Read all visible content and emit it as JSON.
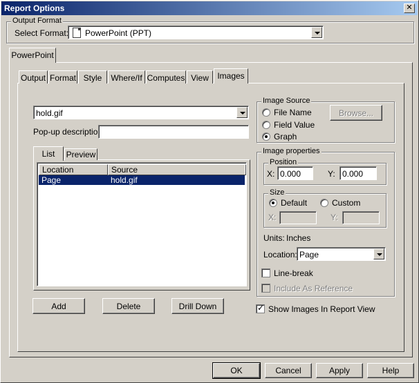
{
  "window": {
    "title": "Report Options",
    "close_glyph": "✕"
  },
  "output_format": {
    "group_label": "Output Format",
    "select_label": "Select Format:",
    "selected": "PowerPoint (PPT)"
  },
  "outer_tab": "PowerPoint",
  "tabs": [
    "Output",
    "Format",
    "Style",
    "Where/If",
    "Computes",
    "View",
    "Images"
  ],
  "images": {
    "image_combo": "hold.gif",
    "popup_label": "Pop-up description:",
    "popup_value": "",
    "subtabs": [
      "List",
      "Preview"
    ],
    "columns": [
      "Location",
      "Source"
    ],
    "rows": [
      {
        "location": "Page",
        "source": "hold.gif"
      }
    ],
    "buttons": {
      "add": "Add",
      "delete": "Delete",
      "drill_down": "Drill Down"
    }
  },
  "image_source": {
    "group_label": "Image Source",
    "options": [
      "File Name",
      "Field Value",
      "Graph"
    ],
    "selected": "Graph",
    "browse": "Browse..."
  },
  "image_properties": {
    "group_label": "Image properties",
    "position_label": "Position",
    "x_label": "X:",
    "y_label": "Y:",
    "x_value": "0.000",
    "y_value": "0.000",
    "size_label": "Size",
    "size_default": "Default",
    "size_custom": "Custom",
    "size_x_label": "X:",
    "size_y_label": "Y:",
    "units_label": "Units:",
    "units_value": "Inches",
    "location_label": "Location:",
    "location_value": "Page",
    "line_break": "Line-break",
    "include_ref": "Include As Reference"
  },
  "show_images": "Show Images In Report View",
  "footer": {
    "ok": "OK",
    "cancel": "Cancel",
    "apply": "Apply",
    "help": "Help"
  }
}
